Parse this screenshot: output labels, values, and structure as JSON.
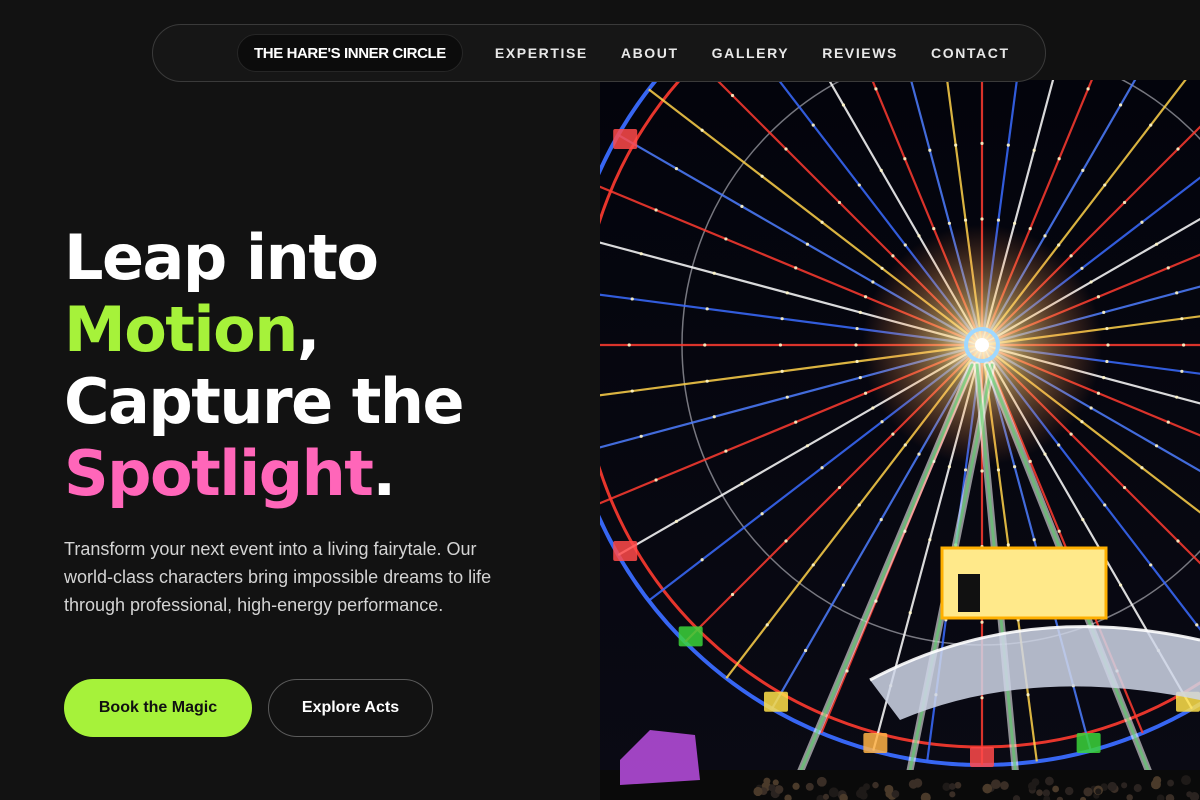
{
  "nav": {
    "brand": "THE HARE'S INNER CIRCLE",
    "links": [
      "EXPERTISE",
      "ABOUT",
      "GALLERY",
      "REVIEWS",
      "CONTACT"
    ]
  },
  "hero": {
    "line1": "Leap into",
    "line2_accent": "Motion",
    "line2_punct": ",",
    "line3": "Capture the",
    "line4_accent": "Spotlight",
    "line4_punct": ".",
    "description": "Transform your next event into a living fairytale. Our world-class characters bring impossible dreams to life through professional, high-energy performance.",
    "primary_button": "Book the Magic",
    "secondary_button": "Explore Acts"
  },
  "colors": {
    "accent_green": "#a6f23a",
    "accent_pink": "#ff66b9",
    "background": "#111111"
  },
  "image": {
    "subject": "ferris-wheel-night-photo"
  }
}
